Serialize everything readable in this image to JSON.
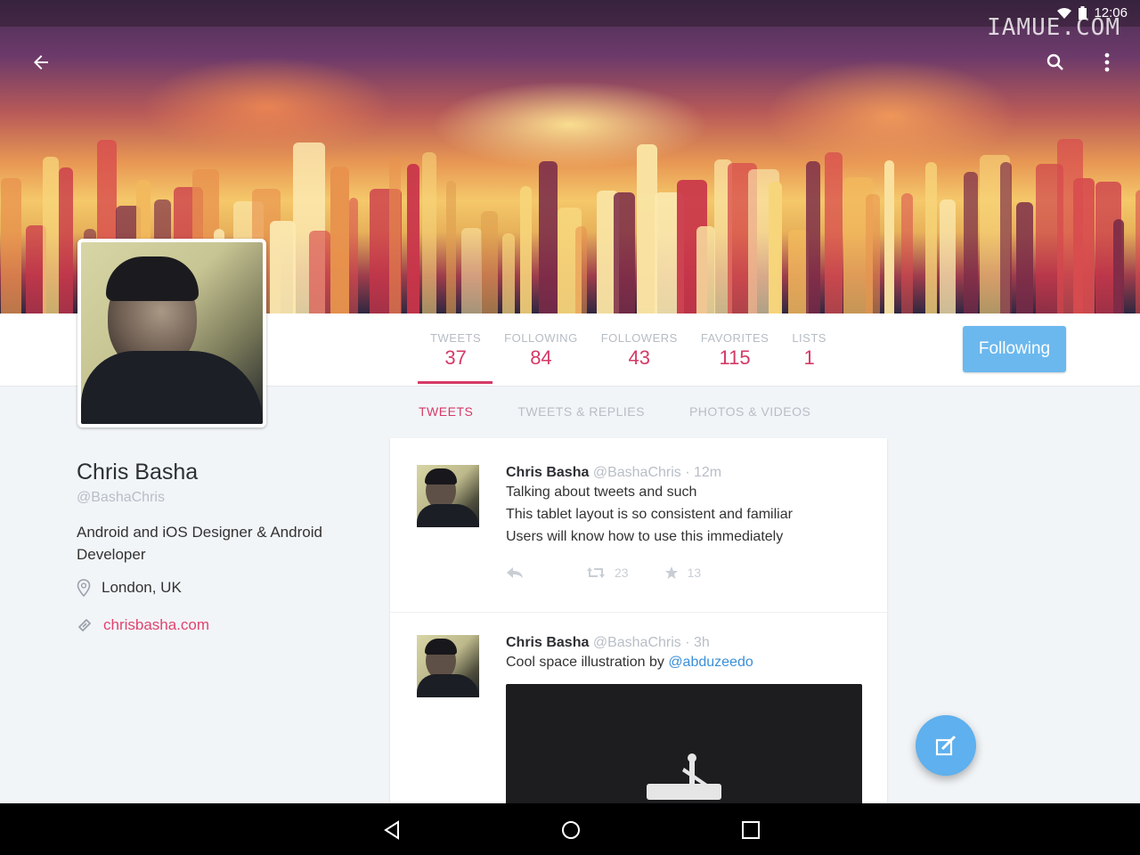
{
  "status_bar": {
    "time": "12:06",
    "watermark": "IAMUE.COM"
  },
  "profile": {
    "name": "Chris Basha",
    "handle": "@BashaChris",
    "bio": "Android and iOS Designer & Android Developer",
    "location": "London, UK",
    "website": "chrisbasha.com"
  },
  "stats": [
    {
      "label": "TWEETS",
      "value": "37"
    },
    {
      "label": "FOLLOWING",
      "value": "84"
    },
    {
      "label": "FOLLOWERS",
      "value": "43"
    },
    {
      "label": "FAVORITES",
      "value": "115"
    },
    {
      "label": "LISTS",
      "value": "1"
    }
  ],
  "follow_button": {
    "label": "Following"
  },
  "tabs": [
    {
      "label": "TWEETS",
      "active": true
    },
    {
      "label": "TWEETS & REPLIES"
    },
    {
      "label": "PHOTOS & VIDEOS"
    }
  ],
  "tweets": [
    {
      "name": "Chris Basha",
      "handle": "@BashaChris",
      "time": "· 12m",
      "lines": [
        "Talking about tweets and such",
        "This tablet layout is so consistent and familiar",
        "Users will know how to use this immediately"
      ],
      "retweets": "23",
      "favorites": "13"
    },
    {
      "name": "Chris Basha",
      "handle": "@BashaChris",
      "time": "· 3h",
      "text": "Cool space illustration by ",
      "mention": "@abduzeedo"
    }
  ],
  "colors": {
    "accent": "#d53a66",
    "link": "#e0446f",
    "follow_bg": "#6bb8ee",
    "fab_bg": "#5eb0ee"
  },
  "icons": [
    "back-arrow-icon",
    "search-icon",
    "overflow-menu-icon",
    "location-pin-icon",
    "link-icon",
    "reply-icon",
    "retweet-icon",
    "star-icon",
    "compose-icon",
    "nav-back-icon",
    "nav-home-icon",
    "nav-recents-icon",
    "wifi-icon",
    "battery-icon"
  ]
}
